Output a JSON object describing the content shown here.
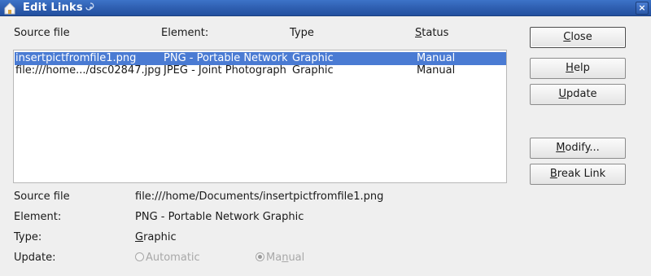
{
  "window": {
    "title": "Edit Links"
  },
  "headers": {
    "source": "Source file",
    "element": "Element:",
    "type": "Type",
    "status": "Status"
  },
  "links": [
    {
      "source": "insertpictfromfile1.png",
      "element": "PNG - Portable Network",
      "type": "Graphic",
      "status": "Manual",
      "selected": true
    },
    {
      "source": "file:///home.../dsc02847.jpg",
      "element": "JPEG - Joint Photographic",
      "type": "Graphic",
      "status": "Manual",
      "selected": false
    }
  ],
  "buttons": {
    "close": "Close",
    "help": "Help",
    "update": "Update",
    "modify": "Modify...",
    "break_link": "Break Link"
  },
  "details": {
    "source_label": "Source file",
    "source_value": "file:///home/Documents/insertpictfromfile1.png",
    "element_label": "Element:",
    "element_value": "PNG - Portable Network Graphic",
    "type_label": "Type:",
    "type_value": "Graphic",
    "update_label": "Update:",
    "automatic_label": "Automatic",
    "manual_label": "Manual",
    "update_mode": "Manual"
  }
}
